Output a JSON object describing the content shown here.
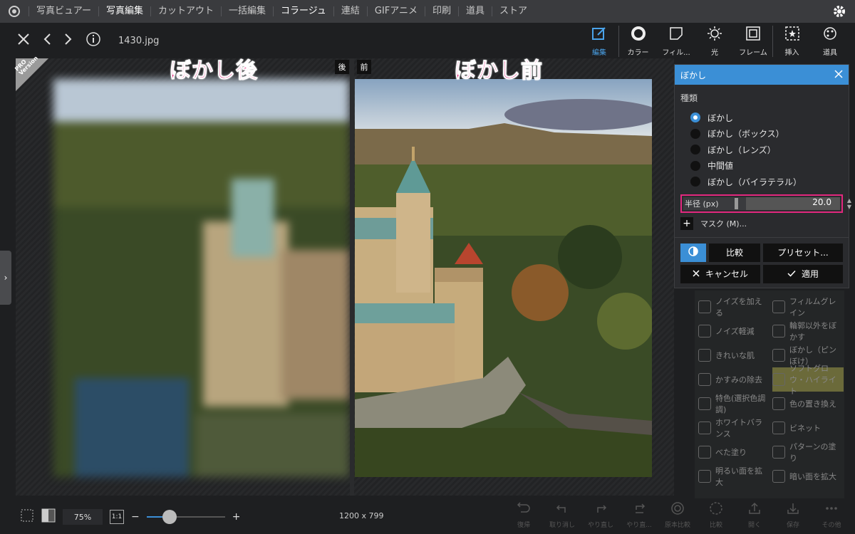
{
  "topnav": {
    "items": [
      "写真ビュアー",
      "写真編集",
      "カットアウト",
      "一括編集",
      "コラージュ",
      "連結",
      "GIFアニメ",
      "印刷",
      "道具",
      "ストア"
    ]
  },
  "file": {
    "name": "1430.jpg"
  },
  "tools": [
    {
      "label": "編集",
      "icon": "edit-icon"
    },
    {
      "label": "カラー",
      "icon": "color-icon"
    },
    {
      "label": "フィル...",
      "icon": "filter-icon"
    },
    {
      "label": "光",
      "icon": "light-icon"
    },
    {
      "label": "フレーム",
      "icon": "frame-icon"
    },
    {
      "label": "挿入",
      "icon": "insert-icon"
    },
    {
      "label": "道具",
      "icon": "tools-icon"
    }
  ],
  "captions": {
    "left": "ぼかし後",
    "right": "ぼかし前"
  },
  "tags": {
    "after": "後",
    "before": "前"
  },
  "pro": {
    "line1": "PRO",
    "line2": "Version"
  },
  "panel": {
    "title": "ぼかし",
    "type_label": "種類",
    "options": [
      "ぼかし",
      "ぼかし（ボックス）",
      "ぼかし（レンズ）",
      "中間値",
      "ぼかし（バイラテラル）"
    ],
    "selected_index": 0,
    "radius_label": "半径 (px)",
    "radius_value": "20.0",
    "mask_label": "マスク (M)...",
    "compare_label": "比較",
    "preset_label": "プリセット...",
    "cancel_label": "キャンセル",
    "apply_label": "適用"
  },
  "bg_filters": [
    "ノイズを加える",
    "フィルムグレイン",
    "ノイズ軽減",
    "輪郭以外をぼかす",
    "きれいな肌",
    "ぼかし（ピンぼけ）",
    "かすみの除去",
    "ソフトグロウ・ハイライト",
    "特色(選択色調調)",
    "色の置き換え",
    "ホワイトバランス",
    "ビネット",
    "べた塗り",
    "パターンの塗り",
    "明るい面を拡大",
    "暗い面を拡大"
  ],
  "bottom": {
    "zoom": "75%",
    "one_to_one": "1:1",
    "dimensions": "1200 x 799",
    "tools": [
      "復帰",
      "取り消し",
      "やり直し",
      "やり直...",
      "原本比較",
      "比較",
      "開く",
      "保存",
      "その他"
    ]
  },
  "colors": {
    "accent": "#3b8fd6",
    "caption": "#e2287e"
  }
}
